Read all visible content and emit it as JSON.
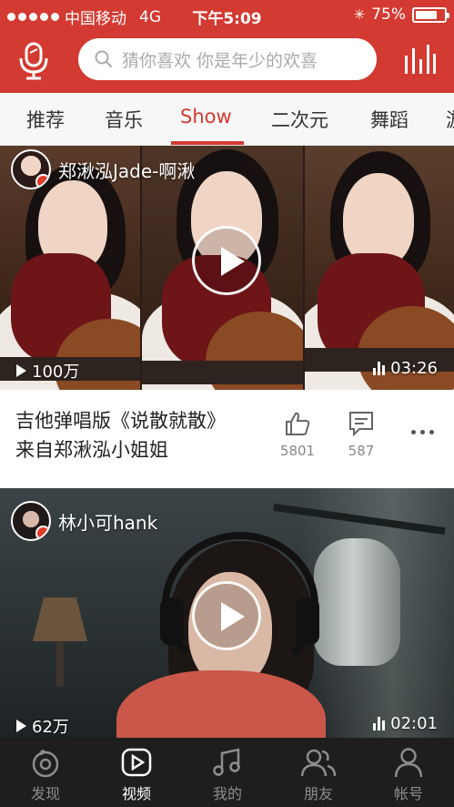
{
  "status_bar": {
    "carrier": "中国移动",
    "network": "4G",
    "time": "下午5:09",
    "battery_text": "75%",
    "battery_level": 0.75
  },
  "header": {
    "search_placeholder": "猜你喜欢 你是年少的欢喜",
    "mic_icon": "mic-icon",
    "bars_icon": "equalizer-icon"
  },
  "tabs": [
    {
      "label": "推荐",
      "active": false
    },
    {
      "label": "音乐",
      "active": false
    },
    {
      "label": "Show",
      "active": true
    },
    {
      "label": "二次元",
      "active": false
    },
    {
      "label": "舞蹈",
      "active": false
    },
    {
      "label": "游",
      "active": false
    }
  ],
  "feed": [
    {
      "author": "郑湫泓Jade-啊湫",
      "plays": "100万",
      "duration": "03:26",
      "title_line1": "吉他弹唱版《说散就散》",
      "title_line2": "来自郑湫泓小姐姐",
      "likes": "5801",
      "comments": "587"
    },
    {
      "author": "林小可hank",
      "plays": "62万",
      "duration": "02:01"
    }
  ],
  "bottom_nav": [
    {
      "label": "发现",
      "icon": "discover-icon",
      "active": false
    },
    {
      "label": "视频",
      "icon": "video-icon",
      "active": true
    },
    {
      "label": "我的",
      "icon": "music-note-icon",
      "active": false
    },
    {
      "label": "朋友",
      "icon": "friends-icon",
      "active": false
    },
    {
      "label": "帐号",
      "icon": "account-icon",
      "active": false
    }
  ],
  "colors": {
    "brand_red": "#d33a31",
    "nav_bg": "#1e1e1e",
    "nav_active": "#ffffff",
    "nav_inactive": "#8d8d8d"
  }
}
